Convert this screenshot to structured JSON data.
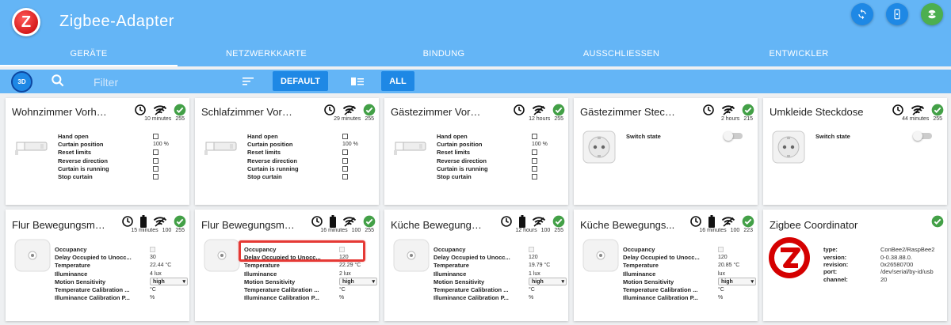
{
  "app": {
    "title": "Zigbee-Adapter",
    "logo_letter": "Z"
  },
  "tabs": [
    "GERÄTE",
    "NETZWERKKARTE",
    "BINDUNG",
    "AUSSCHLIESSEN",
    "ENTWICKLER"
  ],
  "toolbar": {
    "btn_3d": "3D",
    "filter_placeholder": "Filter",
    "default_label": "DEFAULT",
    "all_label": "ALL"
  },
  "cards": [
    {
      "title": "Wohnzimmer Vorhang",
      "time": "10 minutes",
      "signal": "255",
      "rows": [
        [
          "Hand open",
          ""
        ],
        [
          "Curtain position",
          "100 %"
        ],
        [
          "Reset limits",
          ""
        ],
        [
          "Reverse direction",
          ""
        ],
        [
          "Curtain is running",
          ""
        ],
        [
          "Stop curtain",
          ""
        ]
      ]
    },
    {
      "title": "Schlafzimmer Vorhang",
      "time": "29 minutes",
      "signal": "255",
      "rows": [
        [
          "Hand open",
          ""
        ],
        [
          "Curtain position",
          "100 %"
        ],
        [
          "Reset limits",
          ""
        ],
        [
          "Reverse direction",
          ""
        ],
        [
          "Curtain is running",
          ""
        ],
        [
          "Stop curtain",
          ""
        ]
      ]
    },
    {
      "title": "Gästezimmer Vorhang",
      "time": "12 hours",
      "signal": "255",
      "rows": [
        [
          "Hand open",
          ""
        ],
        [
          "Curtain position",
          "100 %"
        ],
        [
          "Reset limits",
          ""
        ],
        [
          "Reverse direction",
          ""
        ],
        [
          "Curtain is running",
          ""
        ],
        [
          "Stop curtain",
          ""
        ]
      ]
    },
    {
      "title": "Gästezimmer Steckdose",
      "time": "2 hours",
      "signal": "215",
      "rows": [
        [
          "Switch state",
          ""
        ]
      ]
    },
    {
      "title": "Umkleide Steckdose",
      "time": "44 minutes",
      "signal": "255",
      "rows": [
        [
          "Switch state",
          ""
        ]
      ]
    },
    {
      "title": "Flur Bewegungsme...",
      "time": "15 minutes",
      "battery": "100",
      "signal": "255",
      "rows": [
        [
          "Occupancy",
          ""
        ],
        [
          "Delay Occupied to Unocc...",
          "30"
        ],
        [
          "Temperature",
          "22.44 °C"
        ],
        [
          "Illuminance",
          "4 lux"
        ],
        [
          "Motion Sensitivity",
          "high"
        ],
        [
          "Temperature Calibration ...",
          "°C"
        ],
        [
          "Illuminance Calibration P...",
          "%"
        ]
      ]
    },
    {
      "title": "Flur Bewegungsme...",
      "time": "16 minutes",
      "battery": "100",
      "signal": "255",
      "rows": [
        [
          "Occupancy",
          ""
        ],
        [
          "Delay Occupied to Unocc...",
          "120"
        ],
        [
          "Temperature",
          "22.29 °C"
        ],
        [
          "Illuminance",
          "2 lux"
        ],
        [
          "Motion Sensitivity",
          "high"
        ],
        [
          "Temperature Calibration ...",
          "°C"
        ],
        [
          "Illuminance Calibration P...",
          "%"
        ]
      ]
    },
    {
      "title": "Küche Bewegungsm...",
      "time": "12 hours",
      "battery": "100",
      "signal": "255",
      "rows": [
        [
          "Occupancy",
          ""
        ],
        [
          "Delay Occupied to Unocc...",
          "120"
        ],
        [
          "Temperature",
          "19.79 °C"
        ],
        [
          "Illuminance",
          "1 lux"
        ],
        [
          "Motion Sensitivity",
          "high"
        ],
        [
          "Temperature Calibration ...",
          "°C"
        ],
        [
          "Illuminance Calibration P...",
          "%"
        ]
      ]
    },
    {
      "title": "Küche Bewegungs...",
      "time": "16 minutes",
      "battery": "100",
      "signal": "223",
      "rows": [
        [
          "Occupancy",
          ""
        ],
        [
          "Delay Occupied to Unocc...",
          "120"
        ],
        [
          "Temperature",
          "20.85 °C"
        ],
        [
          "Illuminance",
          "lux"
        ],
        [
          "Motion Sensitivity",
          "high"
        ],
        [
          "Temperature Calibration ...",
          "°C"
        ],
        [
          "Illuminance Calibration P...",
          "%"
        ]
      ]
    },
    {
      "title": "Zigbee Coordinator",
      "rows": [
        [
          "type:",
          "ConBee2/RaspBee2"
        ],
        [
          "version:",
          "0-0.38.88.0."
        ],
        [
          "revision:",
          "0x26580700"
        ],
        [
          "port:",
          "/dev/serial/by-id/usb"
        ],
        [
          "channel:",
          "20"
        ]
      ]
    }
  ],
  "colors": {
    "header": "#64b5f6",
    "button": "#1e88e5",
    "status_ok": "#43a047",
    "highlight": "#e53935"
  }
}
